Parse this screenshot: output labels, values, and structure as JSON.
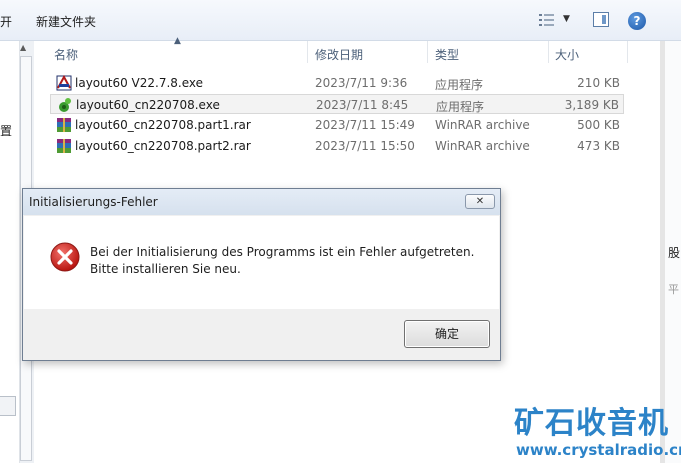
{
  "toolbar": {
    "truncated_label": "开",
    "new_folder_label": "新建文件夹",
    "view_menu_arrow": "▼",
    "help_label": "?"
  },
  "nav": {
    "side_text": "置",
    "scroll_up": "▲"
  },
  "columns": {
    "name": "名称",
    "modified": "修改日期",
    "type": "类型",
    "size": "大小",
    "sort_indicator": "▲"
  },
  "files": [
    {
      "name": "layout60 V22.7.8.exe",
      "modified": "2023/7/11 9:36",
      "type": "应用程序",
      "size": "210 KB",
      "icon": "layout-exe-icon",
      "selected": false
    },
    {
      "name": "layout60_cn220708.exe",
      "modified": "2023/7/11 8:45",
      "type": "应用程序",
      "size": "3,189 KB",
      "icon": "installer-exe-icon",
      "selected": true
    },
    {
      "name": "layout60_cn220708.part1.rar",
      "modified": "2023/7/11 15:49",
      "type": "WinRAR archive",
      "size": "500 KB",
      "icon": "rar-archive-icon",
      "selected": false
    },
    {
      "name": "layout60_cn220708.part2.rar",
      "modified": "2023/7/11 15:50",
      "type": "WinRAR archive",
      "size": "473 KB",
      "icon": "rar-archive-icon",
      "selected": false
    }
  ],
  "right_edge": {
    "text1": "股",
    "text2": "平"
  },
  "dialog": {
    "title": "Initialisierungs-Fehler",
    "close_label": "✕",
    "message_line1": "Bei der Initialisierung des Programms ist ein Fehler aufgetreten.",
    "message_line2": "Bitte installieren Sie neu.",
    "ok_label": "确定"
  },
  "watermark": {
    "line1": "矿石收音机",
    "line2": "www.crystalradio.cn"
  },
  "colors": {
    "accent": "#2c83c8",
    "error_red": "#d32f2f"
  }
}
